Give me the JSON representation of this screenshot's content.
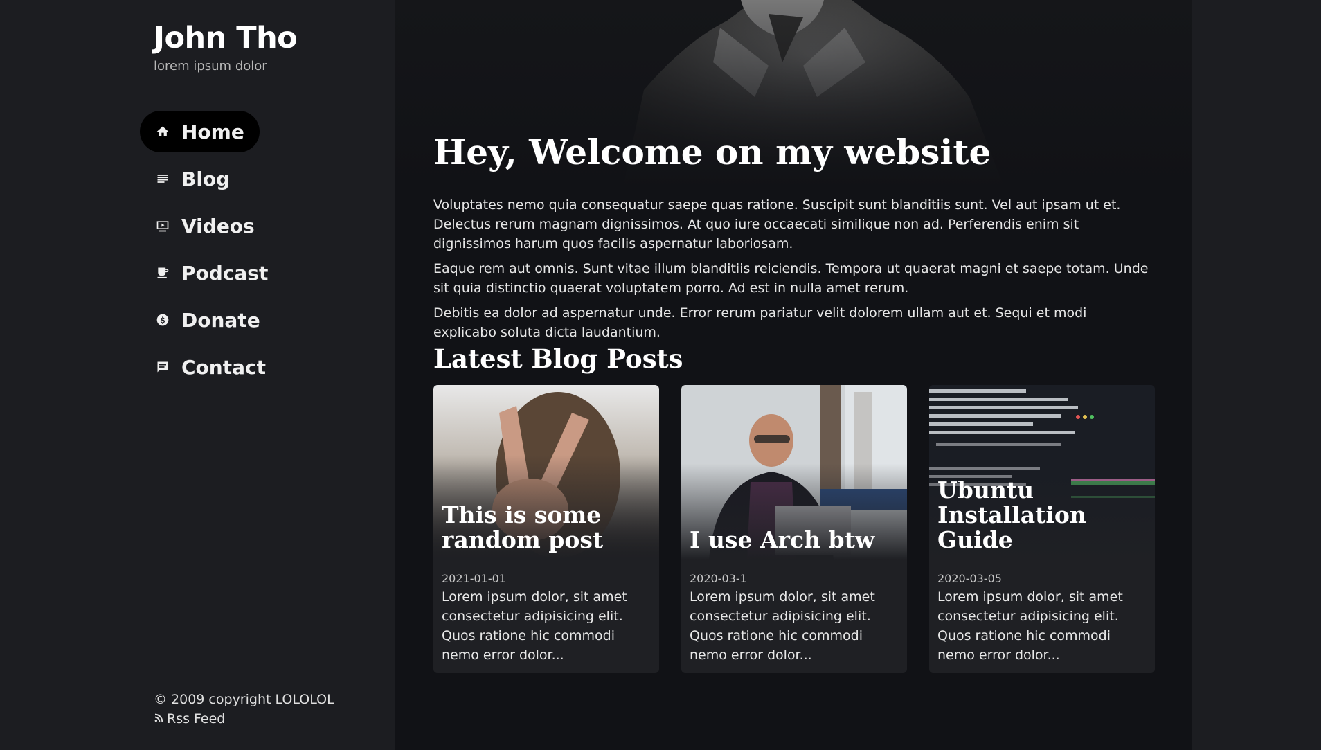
{
  "site": {
    "title": "John Tho",
    "subtitle": "lorem ipsum dolor"
  },
  "nav": [
    {
      "label": "Home",
      "icon": "home-icon",
      "active": true
    },
    {
      "label": "Blog",
      "icon": "list-icon"
    },
    {
      "label": "Videos",
      "icon": "video-icon"
    },
    {
      "label": "Podcast",
      "icon": "coffee-icon"
    },
    {
      "label": "Donate",
      "icon": "dollar-icon"
    },
    {
      "label": "Contact",
      "icon": "chat-icon"
    }
  ],
  "footer": {
    "copyright": "© 2009 copyright LOLOLOL",
    "rss": "Rss Feed"
  },
  "main": {
    "welcome": "Hey, Welcome on my website",
    "paragraphs": [
      "Voluptates nemo quia consequatur saepe quas ratione. Suscipit sunt blanditiis sunt. Vel aut ipsam ut et. Delectus rerum magnam dignissimos. At quo iure occaecati similique non ad. Perferendis enim sit dignissimos harum quos facilis aspernatur laboriosam.",
      "Eaque rem aut omnis. Sunt vitae illum blanditiis reiciendis. Tempora ut quaerat magni et saepe totam. Unde sit quia distinctio quaerat voluptatem porro. Ad est in nulla amet rerum.",
      "Debitis ea dolor ad aspernatur unde. Error rerum pariatur velit dolorem ullam aut et. Sequi et modi explicabo soluta dicta laudantium."
    ],
    "latest_heading": "Latest Blog Posts",
    "posts": [
      {
        "title": "This is some random post",
        "date": "2021-01-01",
        "excerpt": "Lorem ipsum dolor, sit amet consectetur adipisicing elit. Quos ratione hic commodi nemo error dolor..."
      },
      {
        "title": "I use Arch btw",
        "date": "2020-03-1",
        "excerpt": "Lorem ipsum dolor, sit amet consectetur adipisicing elit. Quos ratione hic commodi nemo error dolor..."
      },
      {
        "title": "Ubuntu Installation Guide",
        "date": "2020-03-05",
        "excerpt": "Lorem ipsum dolor, sit amet consectetur adipisicing elit. Quos ratione hic commodi nemo error dolor..."
      }
    ]
  }
}
